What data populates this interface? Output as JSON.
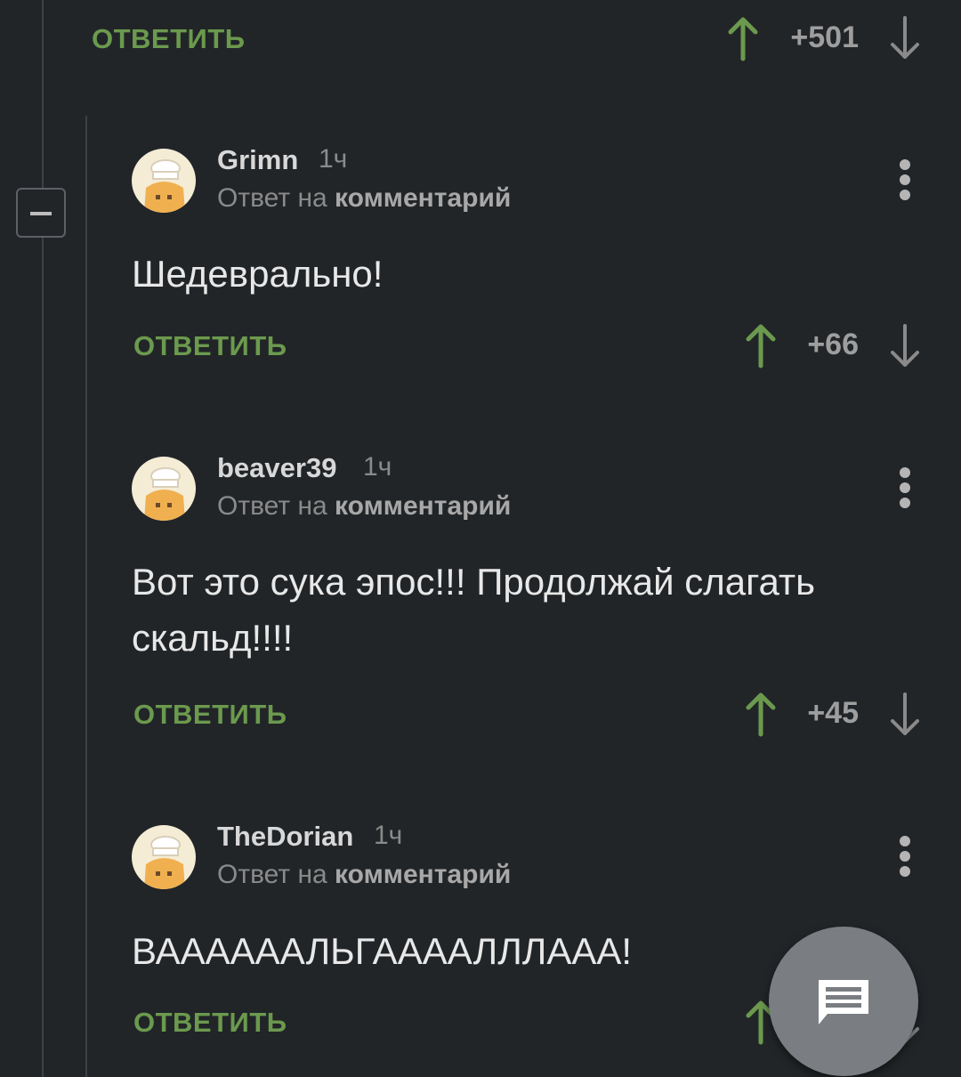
{
  "top_bar": {
    "reply_label": "ОТВЕТИТЬ",
    "score": "+501"
  },
  "comments": [
    {
      "username": "Grimn",
      "time": "1ч",
      "reply_prefix": "Ответ на",
      "reply_target": "комментарий",
      "text": "Шедеврально!",
      "reply_label": "ОТВЕТИТЬ",
      "score": "+66"
    },
    {
      "username": "beaver39",
      "time": "1ч",
      "reply_prefix": "Ответ на",
      "reply_target": "комментарий",
      "text": "Вот это сука эпос!!! Продолжай слагать скальд!!!!",
      "reply_label": "ОТВЕТИТЬ",
      "score": "+45"
    },
    {
      "username": "TheDorian",
      "time": "1ч",
      "reply_prefix": "Ответ на",
      "reply_target": "комментарий",
      "text": "ВААААААЛЬГААААЛЛЛААА!",
      "reply_label": "ОТВЕТИТЬ",
      "score": ""
    }
  ],
  "colors": {
    "background": "#222528",
    "accent_green": "#6b9a4e",
    "text": "#e8e8e8",
    "muted": "#8a8a8a"
  },
  "icons": {
    "upvote": "arrow-up-icon",
    "downvote": "arrow-down-icon",
    "menu": "more-vertical-icon",
    "collapse": "minus-icon",
    "fab": "comment-icon"
  }
}
